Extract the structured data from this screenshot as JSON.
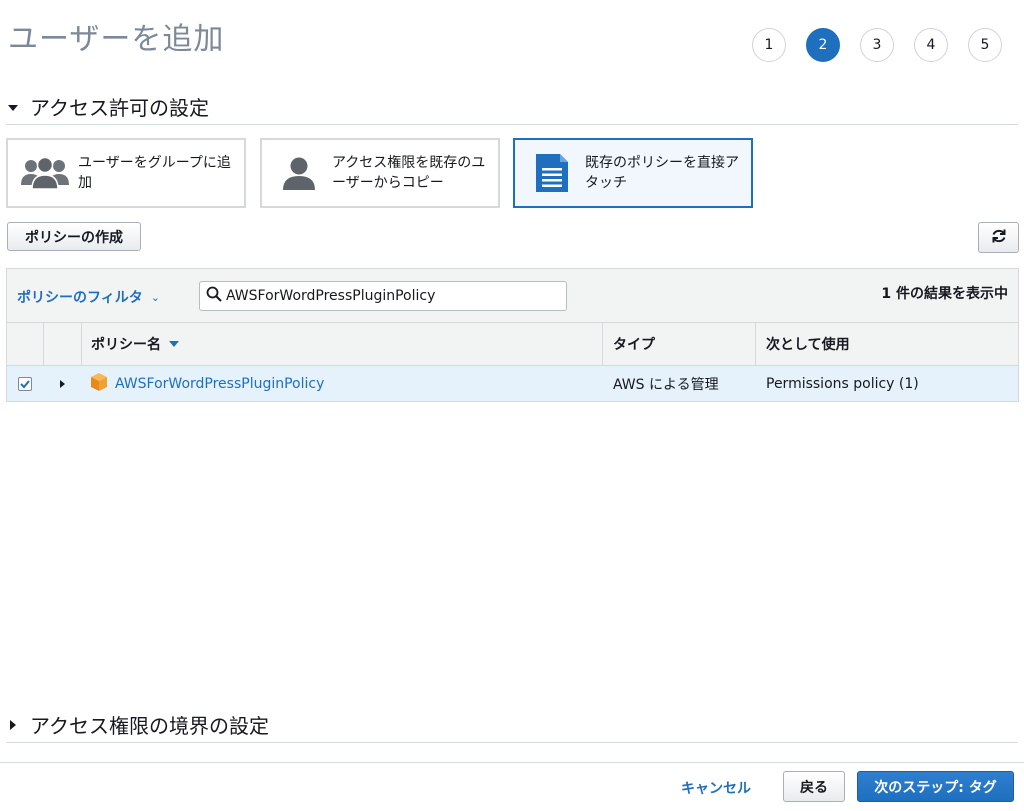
{
  "page": {
    "title": "ユーザーを追加"
  },
  "steps": [
    {
      "label": "1",
      "active": false
    },
    {
      "label": "2",
      "active": true
    },
    {
      "label": "3",
      "active": false
    },
    {
      "label": "4",
      "active": false
    },
    {
      "label": "5",
      "active": false
    }
  ],
  "permissions": {
    "title": "アクセス許可の設定",
    "options": [
      {
        "label": "ユーザーをグループに追加",
        "icon": "group-users-icon",
        "selected": false
      },
      {
        "label": "アクセス権限を既存のユーザーからコピー",
        "icon": "user-icon",
        "selected": false
      },
      {
        "label": "既存のポリシーを直接アタッチ",
        "icon": "document-icon",
        "selected": true
      }
    ],
    "create_policy_label": "ポリシーの作成",
    "refresh_icon": "refresh-icon"
  },
  "filter": {
    "label": "ポリシーのフィルタ",
    "search_value": "AWSForWordPressPluginPolicy",
    "result_count": "1 件の結果を表示中"
  },
  "table": {
    "headers": {
      "name": "ポリシー名",
      "type": "タイプ",
      "used_as": "次として使用"
    },
    "rows": [
      {
        "checked": true,
        "name": "AWSForWordPressPluginPolicy",
        "type": "AWS による管理",
        "used_as": "Permissions policy (1)"
      }
    ]
  },
  "boundary": {
    "title": "アクセス権限の境界の設定"
  },
  "footer": {
    "cancel_label": "キャンセル",
    "back_label": "戻る",
    "next_label": "次のステップ: タグ"
  },
  "colors": {
    "accent": "#1f6fbf",
    "selected_row": "#e5f2fb",
    "aws_orange": "#f0a132"
  }
}
